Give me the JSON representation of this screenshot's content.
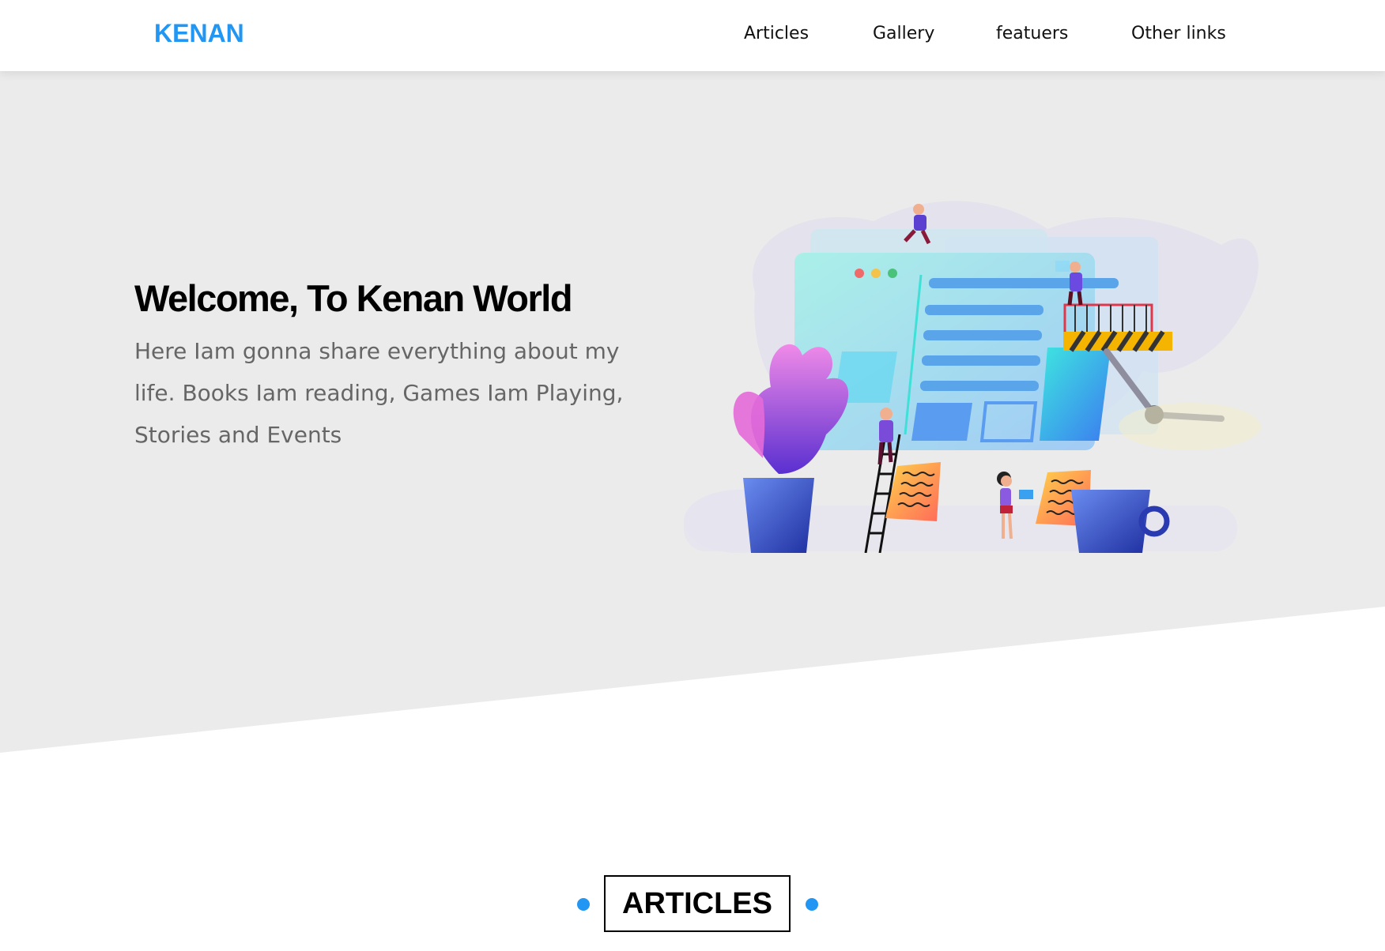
{
  "header": {
    "logo": "KENAN",
    "nav": [
      {
        "label": "Articles"
      },
      {
        "label": "Gallery"
      },
      {
        "label": "featuers"
      },
      {
        "label": "Other links"
      }
    ]
  },
  "hero": {
    "title": "Welcome, To Kenan World",
    "text": "Here Iam gonna share everything about my life. Books Iam reading, Games Iam Playing, Stories and Events"
  },
  "articles": {
    "heading": "ARTICLES"
  },
  "colors": {
    "accent": "#2196f3",
    "hero_bg": "#ebebeb",
    "body_text": "#666666"
  }
}
